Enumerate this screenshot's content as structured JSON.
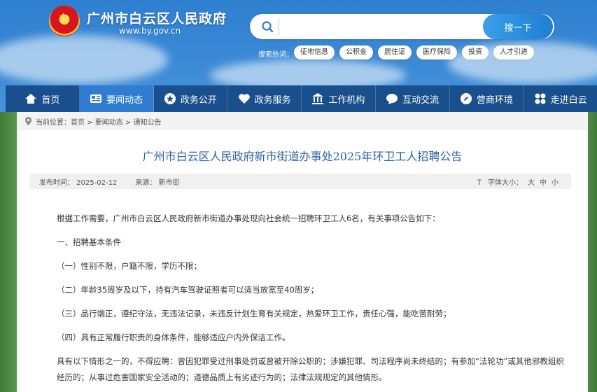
{
  "header": {
    "site_title": "广州市白云区人民政府",
    "site_url": "www.by.gov.cn",
    "search": {
      "placeholder": "",
      "button_label": "搜一下"
    },
    "hot_label": "搜索热词：",
    "hot_tags": [
      "征地信息",
      "公积金",
      "居住证",
      "医疗保险",
      "投资",
      "人才引进"
    ]
  },
  "nav": {
    "items": [
      {
        "label": "首页",
        "icon": "home-icon"
      },
      {
        "label": "要闻动态",
        "icon": "news-icon",
        "active": true
      },
      {
        "label": "政务公开",
        "icon": "star-icon"
      },
      {
        "label": "政务服务",
        "icon": "heart-icon"
      },
      {
        "label": "工作机构",
        "icon": "building-icon"
      },
      {
        "label": "互动交流",
        "icon": "chat-icon"
      },
      {
        "label": "营商环境",
        "icon": "compass-icon"
      },
      {
        "label": "走进白云",
        "icon": "grid-icon"
      }
    ]
  },
  "breadcrumb": {
    "prefix": "当前位置：",
    "path": "首页 > 要闻动态 > 通知公告"
  },
  "article": {
    "title": "广州市白云区人民政府新市街道办事处2025年环卫工人招聘公告",
    "published": "发布时间：  2025-02-12",
    "source": "来源：  新市街",
    "font_size_label": "字体大小：",
    "font_sizes": [
      "大",
      "中",
      "小"
    ],
    "paragraphs": [
      "根据工作需要，广州市白云区人民政府新市街道办事处现向社会统一招聘环卫工人6名，有关事项公告如下：",
      "一、招聘基本条件",
      "（一）性别不限，户籍不限，学历不限；",
      "（二）年龄35周岁及以下，持有汽车驾驶证照者可以适当放宽至40周岁；",
      "（三）品行端正，遵纪守法，无违法记录，未违反计划生育有关规定，热爱环卫工作，责任心强，能吃苦耐劳；",
      "（四）具有正常履行职责的身体条件，能够适应户内外保洁工作。",
      "具有以下情形之一的，不得应聘：曾因犯罪受过刑事处罚或曾被开除公职的；涉嫌犯罪、司法程序尚未终结的；有参加“法轮功”或其他邪教组织",
      "经历的；从事过危害国家安全活动的；道德品质上有劣迹行为的；法律法规规定的其他情形。"
    ]
  },
  "colors": {
    "nav_bg": "#1a4f8d",
    "nav_active": "#2f7cd0",
    "title": "#2b64a8"
  }
}
